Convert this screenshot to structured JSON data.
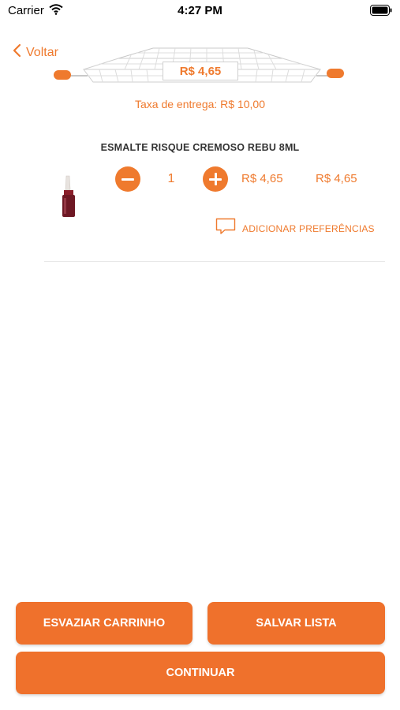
{
  "status_bar": {
    "carrier": "Carrier",
    "time": "4:27 PM"
  },
  "nav": {
    "back_label": "Voltar"
  },
  "cart": {
    "total": "R$ 4,65",
    "delivery_fee": "Taxa de entrega: R$ 10,00"
  },
  "item": {
    "name": "ESMALTE RISQUE CREMOSO REBU 8ML",
    "quantity": "1",
    "unit_price": "R$ 4,65",
    "total_price": "R$ 4,65",
    "preferences_label": "ADICIONAR PREFERÊNCIAS"
  },
  "actions": {
    "empty_cart": "ESVAZIAR CARRINHO",
    "save_list": "SALVAR LISTA",
    "continue": "CONTINUAR"
  },
  "colors": {
    "accent": "#ef7a2e",
    "button": "#ef712c"
  }
}
